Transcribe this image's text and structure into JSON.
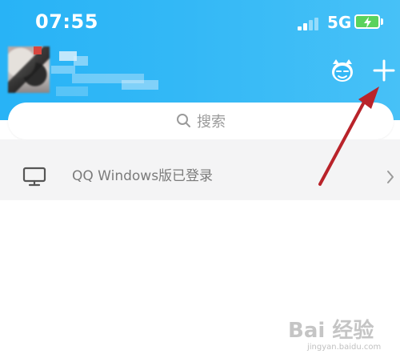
{
  "status_bar": {
    "time": "07:55",
    "network": "5G",
    "battery_color": "#5ad25c"
  },
  "header": {
    "background_color": "#33b8f6",
    "actions": [
      {
        "icon": "mascot-face-icon"
      },
      {
        "icon": "plus-icon"
      }
    ]
  },
  "search": {
    "placeholder": "搜索",
    "icon": "search-icon"
  },
  "device_login": {
    "label": "QQ Windows版已登录",
    "icon": "monitor-icon",
    "chevron_icon": "chevron-right-icon"
  },
  "annotation": {
    "color": "#b9232a",
    "icon": "red-arrow-icon"
  },
  "watermark": {
    "main": "Bai 经验",
    "sub": "jingyan.baidu.com"
  }
}
